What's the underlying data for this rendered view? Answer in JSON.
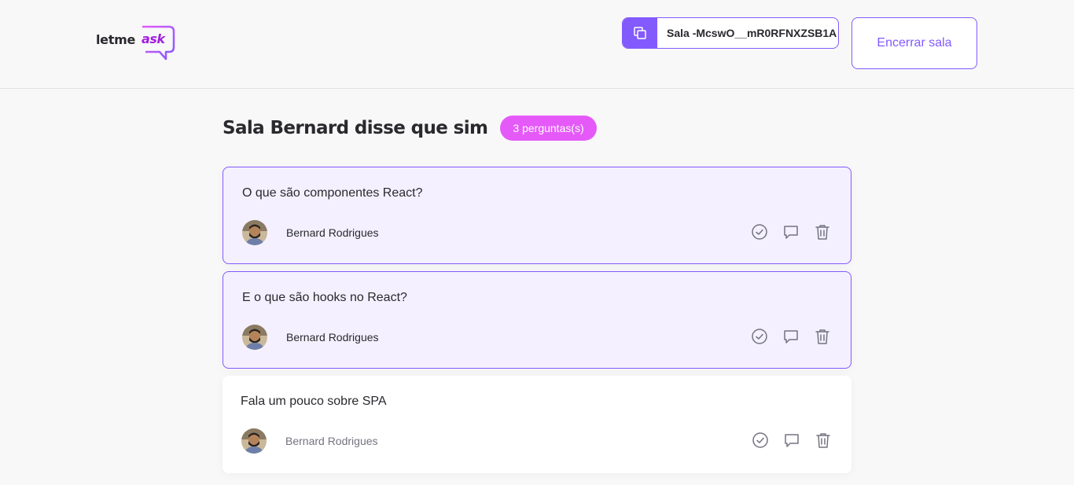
{
  "header": {
    "logo": {
      "text": "letme",
      "accent": "ask"
    },
    "room_code": {
      "label": "Sala -McswO__mR0RFNXZSB1A",
      "icon": "copy-icon"
    },
    "end_room_label": "Encerrar sala"
  },
  "room": {
    "title": "Sala Bernard disse que sim",
    "count_label": "3 perguntas(s)"
  },
  "questions": [
    {
      "content": "O que são componentes React?",
      "author": "Bernard Rodrigues",
      "highlighted": true
    },
    {
      "content": "E o que são hooks no React?",
      "author": "Bernard Rodrigues",
      "highlighted": true
    },
    {
      "content": "Fala um pouco sobre SPA",
      "author": "Bernard Rodrigues",
      "highlighted": false
    }
  ],
  "icons": {
    "check": "check-circle-icon",
    "answer": "chat-bubble-icon",
    "delete": "trash-icon"
  },
  "colors": {
    "purple": "#835afd",
    "pink": "#e559f9",
    "highlight_bg": "#f4f0ff",
    "text": "#29292e",
    "muted": "#737380"
  }
}
